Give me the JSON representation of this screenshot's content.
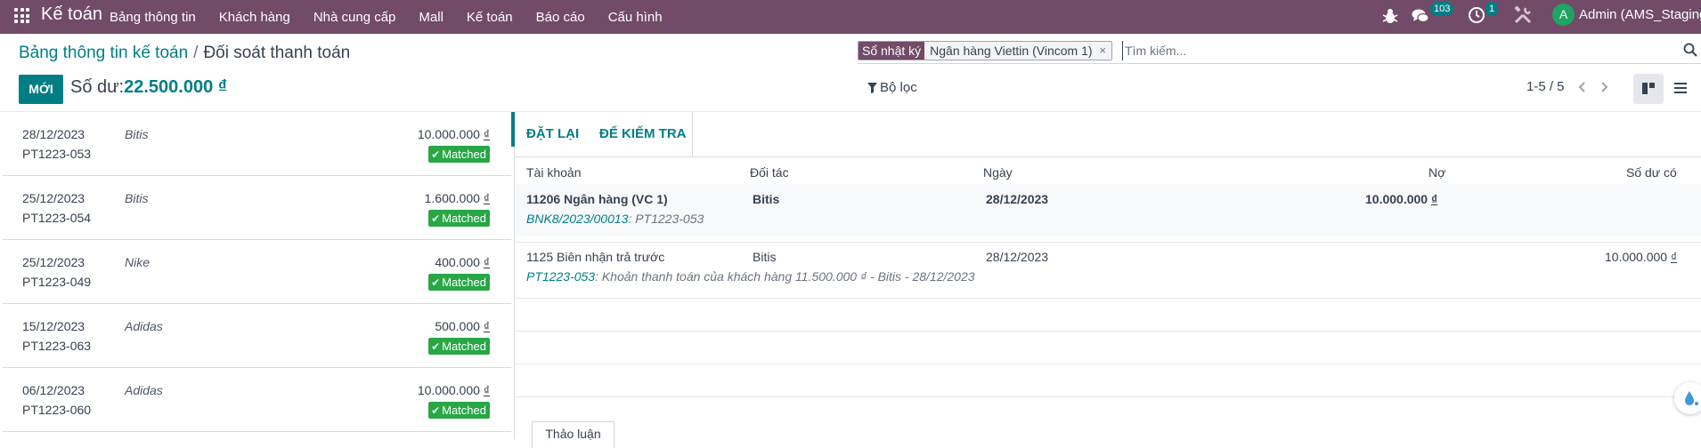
{
  "navbar": {
    "brand": "Kế toán",
    "menu": [
      "Bảng thông tin",
      "Khách hàng",
      "Nhà cung cấp",
      "Mall",
      "Kế toán",
      "Báo cáo",
      "Cấu hình"
    ],
    "messages_count": "103",
    "activities_count": "1",
    "avatar_letter": "A",
    "user": "Admin (AMS_Staging)",
    "bg_color": "#714b67"
  },
  "breadcrumb": {
    "parent": "Bảng thông tin kế toán",
    "separator": "/",
    "current": "Đối soát thanh toán"
  },
  "new_button": "MỚI",
  "balance": {
    "label": "Số dư:",
    "amount": "22.500.000 ₫"
  },
  "search": {
    "facet_label": "Sổ nhật ký",
    "facet_value": "Ngân hàng Viettin (Vincom 1)",
    "facet_remove": "×",
    "placeholder": "Tìm kiếm..."
  },
  "filter_label": "Bộ lọc",
  "pager": "1-5 / 5",
  "statements": [
    {
      "date": "28/12/2023",
      "ref": "PT1223-053",
      "partner": "Bitis",
      "amount": "10.000.000",
      "currency": "₫",
      "status": "Matched"
    },
    {
      "date": "25/12/2023",
      "ref": "PT1223-054",
      "partner": "Bitis",
      "amount": "1.600.000",
      "currency": "₫",
      "status": "Matched"
    },
    {
      "date": "25/12/2023",
      "ref": "PT1223-049",
      "partner": "Nike",
      "amount": "400.000",
      "currency": "₫",
      "status": "Matched"
    },
    {
      "date": "15/12/2023",
      "ref": "PT1223-063",
      "partner": "Adidas",
      "amount": "500.000",
      "currency": "₫",
      "status": "Matched"
    },
    {
      "date": "06/12/2023",
      "ref": "PT1223-060",
      "partner": "Adidas",
      "amount": "10.000.000",
      "currency": "₫",
      "status": "Matched"
    }
  ],
  "detail": {
    "tabs": [
      "ĐẶT LẠI",
      "ĐỂ KIỂM TRA"
    ],
    "columns": [
      "Tài khoản",
      "Đối tác",
      "Ngày",
      "Nợ",
      "Số dư có"
    ],
    "lines": [
      {
        "account": "11206 Ngân hàng (VC 1)",
        "partner": "Bitis",
        "date": "28/12/2023",
        "debit": "10.000.000",
        "credit": "",
        "currency": "₫",
        "sub_link": "BNK8/2023/00013",
        "sub_text": ": PT1223-053"
      },
      {
        "account": "1125 Biên nhận trả trước",
        "partner": "Bitis",
        "date": "28/12/2023",
        "debit": "",
        "credit": "10.000.000",
        "currency": "₫",
        "sub_link": "PT1223-053",
        "sub_text": ": Khoản thanh toán của khách hàng 11.500.000 ₫ - Bitis - 28/12/2023"
      }
    ],
    "chatter_button": "Thảo luận"
  },
  "accent_color": "#017e84",
  "matched_color": "#28a745"
}
